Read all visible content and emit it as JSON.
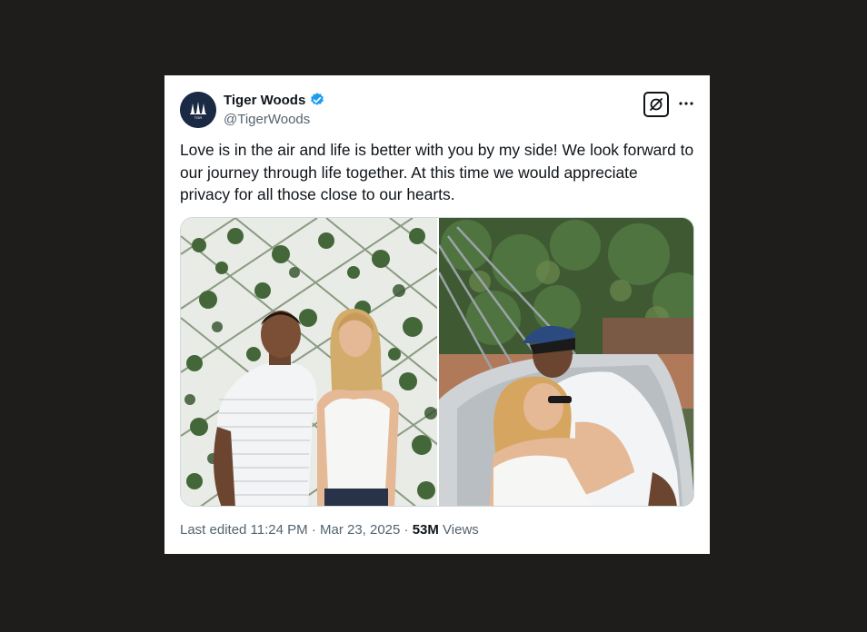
{
  "author": {
    "name": "Tiger Woods",
    "handle": "@TigerWoods",
    "verified": true,
    "avatar_text": "TGR"
  },
  "tweet": {
    "text_lines": [
      "Love is in the air and life is better with you by my side! We look forward to",
      "our journey through life together. At this time we would appreciate",
      "privacy for all those close to our hearts."
    ]
  },
  "meta": {
    "edited_prefix": "Last edited 11:24 PM · Mar 23, 2025 · ",
    "views_count": "53M",
    "views_label": " Views"
  },
  "icons": {
    "verified": "verified-badge-icon",
    "grok": "grok-icon",
    "more": "more-dots-icon"
  },
  "colors": {
    "background": "#1f1d1b",
    "card": "#ffffff",
    "text_primary": "#0f1419",
    "text_secondary": "#536471",
    "verified_blue": "#1d9bf0"
  }
}
